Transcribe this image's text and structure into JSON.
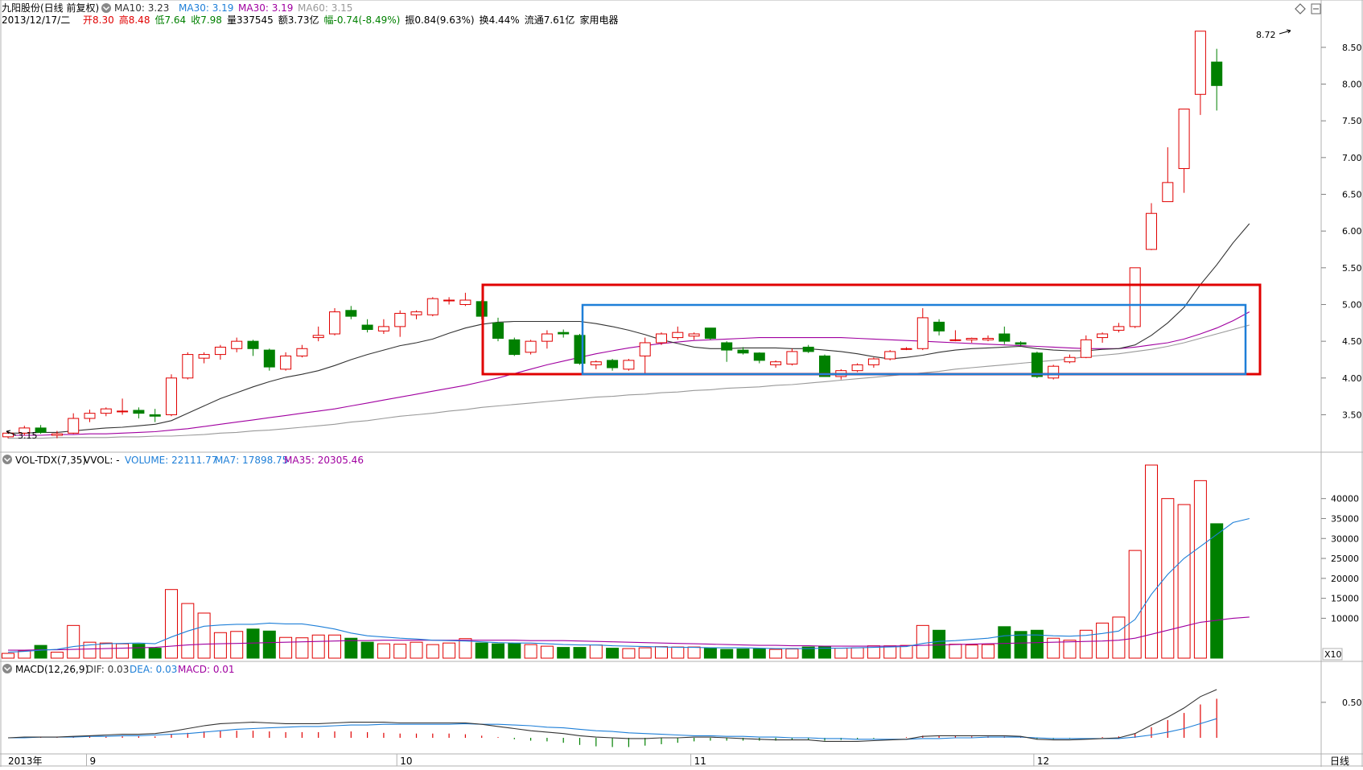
{
  "header": {
    "stock": "九阳股份(日线 前复权)",
    "ma10_label": "MA10: 3.23",
    "ma30a_label": "MA30: 3.19",
    "ma30b_label": "MA30: 3.19",
    "ma60_label": "MA60: 3.15",
    "date": "2013/12/17/二",
    "items": [
      {
        "text": "开8.30",
        "color": "#e00000"
      },
      {
        "text": "高8.48",
        "color": "#e00000"
      },
      {
        "text": "低7.64",
        "color": "#008000"
      },
      {
        "text": "收7.98",
        "color": "#008000"
      },
      {
        "text": "量337545",
        "color": "#000000"
      },
      {
        "text": "额3.73亿",
        "color": "#000000"
      },
      {
        "text": "幅-0.74(-8.49%)",
        "color": "#008000"
      },
      {
        "text": "振0.84(9.63%)",
        "color": "#000000"
      },
      {
        "text": "换4.44%",
        "color": "#000000"
      },
      {
        "text": "流通7.61亿",
        "color": "#000000"
      },
      {
        "text": "家用电器",
        "color": "#000000"
      }
    ]
  },
  "vol_header": {
    "name": "VOL-TDX(7,35)",
    "vvol": "VVOL: -",
    "volume": "VOLUME: 22111.77",
    "ma7": "MA7: 17898.75",
    "ma35": "MA35: 20305.46"
  },
  "macd_header": {
    "name": "MACD(12,26,9)",
    "dif": "DIF: 0.03",
    "dea": "DEA: 0.03",
    "macd": "MACD: 0.01"
  },
  "annotations": {
    "high": "8.72",
    "low": "3.15"
  },
  "x_axis": {
    "year": "2013年",
    "months": [
      "9",
      "10",
      "11",
      "12"
    ]
  },
  "period_label": "日线",
  "vol_unit": "X10",
  "colors": {
    "up": "#e00000",
    "down": "#008000",
    "bg": "#ffffff",
    "grid": "#c0c0c0",
    "ma_short": "#333333",
    "ma_mid": "#a000a0",
    "ma_long": "#999999",
    "ma7": "#1e7fd8",
    "ma35": "#a000a0",
    "dif": "#333333",
    "dea": "#1e7fd8",
    "box_red": "#e00000",
    "box_blue": "#1e7fd8"
  },
  "chart_data": [
    {
      "type": "candlestick",
      "title": "九阳股份(日线 前复权)",
      "price_ticks": [
        "3.50",
        "4.00",
        "4.50",
        "5.00",
        "5.50",
        "6.00",
        "6.50",
        "7.00",
        "7.50",
        "8.00",
        "8.50"
      ],
      "ylim": [
        3.1,
        8.75
      ],
      "ohlc": [
        [
          3.2,
          3.28,
          3.18,
          3.25
        ],
        [
          3.25,
          3.35,
          3.22,
          3.32
        ],
        [
          3.32,
          3.36,
          3.24,
          3.26
        ],
        [
          3.22,
          3.28,
          3.18,
          3.24
        ],
        [
          3.25,
          3.52,
          3.24,
          3.45
        ],
        [
          3.45,
          3.57,
          3.4,
          3.52
        ],
        [
          3.52,
          3.6,
          3.48,
          3.58
        ],
        [
          3.55,
          3.72,
          3.5,
          3.55
        ],
        [
          3.56,
          3.6,
          3.45,
          3.52
        ],
        [
          3.5,
          3.58,
          3.4,
          3.48
        ],
        [
          3.5,
          4.05,
          3.48,
          4.0
        ],
        [
          4.0,
          4.35,
          3.98,
          4.32
        ],
        [
          4.27,
          4.35,
          4.2,
          4.32
        ],
        [
          4.32,
          4.45,
          4.25,
          4.42
        ],
        [
          4.4,
          4.55,
          4.35,
          4.5
        ],
        [
          4.5,
          4.52,
          4.3,
          4.4
        ],
        [
          4.38,
          4.4,
          4.1,
          4.15
        ],
        [
          4.12,
          4.35,
          4.1,
          4.3
        ],
        [
          4.3,
          4.45,
          4.28,
          4.4
        ],
        [
          4.55,
          4.7,
          4.5,
          4.58
        ],
        [
          4.6,
          4.95,
          4.58,
          4.9
        ],
        [
          4.92,
          4.98,
          4.8,
          4.84
        ],
        [
          4.72,
          4.8,
          4.62,
          4.66
        ],
        [
          4.64,
          4.8,
          4.6,
          4.7
        ],
        [
          4.7,
          4.92,
          4.56,
          4.88
        ],
        [
          4.86,
          4.92,
          4.8,
          4.9
        ],
        [
          4.86,
          5.1,
          4.84,
          5.08
        ],
        [
          5.06,
          5.1,
          5.0,
          5.06
        ],
        [
          5.0,
          5.16,
          4.98,
          5.06
        ],
        [
          5.04,
          5.06,
          4.8,
          4.84
        ],
        [
          4.75,
          4.82,
          4.5,
          4.54
        ],
        [
          4.52,
          4.55,
          4.3,
          4.32
        ],
        [
          4.35,
          4.52,
          4.32,
          4.5
        ],
        [
          4.5,
          4.65,
          4.4,
          4.6
        ],
        [
          4.62,
          4.66,
          4.55,
          4.6
        ],
        [
          4.58,
          4.6,
          4.18,
          4.2
        ],
        [
          4.18,
          4.24,
          4.12,
          4.22
        ],
        [
          4.24,
          4.26,
          4.1,
          4.14
        ],
        [
          4.12,
          4.26,
          4.1,
          4.24
        ],
        [
          4.3,
          4.55,
          4.05,
          4.48
        ],
        [
          4.48,
          4.62,
          4.45,
          4.6
        ],
        [
          4.55,
          4.7,
          4.52,
          4.62
        ],
        [
          4.57,
          4.62,
          4.52,
          4.6
        ],
        [
          4.68,
          4.68,
          4.52,
          4.54
        ],
        [
          4.48,
          4.5,
          4.22,
          4.38
        ],
        [
          4.38,
          4.42,
          4.32,
          4.34
        ],
        [
          4.34,
          4.35,
          4.2,
          4.24
        ],
        [
          4.18,
          4.24,
          4.14,
          4.22
        ],
        [
          4.19,
          4.4,
          4.17,
          4.36
        ],
        [
          4.42,
          4.45,
          4.34,
          4.36
        ],
        [
          4.3,
          4.32,
          4.02,
          4.02
        ],
        [
          4.02,
          4.12,
          3.98,
          4.1
        ],
        [
          4.1,
          4.2,
          4.08,
          4.18
        ],
        [
          4.18,
          4.28,
          4.14,
          4.26
        ],
        [
          4.26,
          4.38,
          4.24,
          4.36
        ],
        [
          4.4,
          4.42,
          4.38,
          4.4
        ],
        [
          4.4,
          4.95,
          4.38,
          4.82
        ],
        [
          4.76,
          4.8,
          4.58,
          4.64
        ],
        [
          4.52,
          4.65,
          4.5,
          4.52
        ],
        [
          4.52,
          4.55,
          4.48,
          4.54
        ],
        [
          4.52,
          4.58,
          4.5,
          4.54
        ],
        [
          4.6,
          4.7,
          4.46,
          4.5
        ],
        [
          4.48,
          4.5,
          4.44,
          4.46
        ],
        [
          4.34,
          4.36,
          4.0,
          4.02
        ],
        [
          4.0,
          4.18,
          3.98,
          4.16
        ],
        [
          4.22,
          4.32,
          4.2,
          4.28
        ],
        [
          4.28,
          4.58,
          4.27,
          4.52
        ],
        [
          4.55,
          4.62,
          4.48,
          4.6
        ],
        [
          4.65,
          4.75,
          4.62,
          4.7
        ],
        [
          4.7,
          5.48,
          4.68,
          5.5
        ],
        [
          5.75,
          6.38,
          5.74,
          6.24
        ],
        [
          6.4,
          7.14,
          6.4,
          6.66
        ],
        [
          6.85,
          7.66,
          6.52,
          7.66
        ],
        [
          7.86,
          8.72,
          7.58,
          8.72
        ],
        [
          8.3,
          8.48,
          7.64,
          7.98
        ]
      ],
      "ma_short": [
        3.25,
        3.25,
        3.26,
        3.26,
        3.28,
        3.3,
        3.32,
        3.33,
        3.35,
        3.37,
        3.42,
        3.52,
        3.62,
        3.72,
        3.8,
        3.88,
        3.95,
        4.01,
        4.05,
        4.1,
        4.17,
        4.25,
        4.32,
        4.38,
        4.44,
        4.48,
        4.53,
        4.61,
        4.68,
        4.73,
        4.76,
        4.77,
        4.77,
        4.77,
        4.77,
        4.77,
        4.74,
        4.7,
        4.65,
        4.59,
        4.52,
        4.47,
        4.42,
        4.4,
        4.4,
        4.41,
        4.41,
        4.41,
        4.4,
        4.4,
        4.38,
        4.36,
        4.33,
        4.29,
        4.26,
        4.28,
        4.31,
        4.35,
        4.38,
        4.4,
        4.41,
        4.42,
        4.43,
        4.4,
        4.38,
        4.37,
        4.37,
        4.39,
        4.4,
        4.45,
        4.58,
        4.75,
        4.96,
        5.27,
        5.54,
        5.84,
        6.1
      ],
      "ma_mid": [
        3.22,
        3.22,
        3.22,
        3.23,
        3.23,
        3.24,
        3.24,
        3.25,
        3.26,
        3.27,
        3.29,
        3.31,
        3.34,
        3.37,
        3.4,
        3.43,
        3.46,
        3.49,
        3.52,
        3.55,
        3.58,
        3.62,
        3.66,
        3.7,
        3.74,
        3.78,
        3.82,
        3.86,
        3.9,
        3.95,
        4.0,
        4.06,
        4.12,
        4.18,
        4.23,
        4.28,
        4.33,
        4.37,
        4.41,
        4.44,
        4.47,
        4.49,
        4.51,
        4.52,
        4.53,
        4.54,
        4.55,
        4.55,
        4.55,
        4.55,
        4.55,
        4.55,
        4.54,
        4.53,
        4.52,
        4.51,
        4.5,
        4.49,
        4.48,
        4.47,
        4.46,
        4.45,
        4.44,
        4.43,
        4.42,
        4.41,
        4.4,
        4.4,
        4.4,
        4.42,
        4.45,
        4.48,
        4.53,
        4.6,
        4.68,
        4.78,
        4.9
      ],
      "ma_long": [
        3.18,
        3.18,
        3.18,
        3.19,
        3.19,
        3.19,
        3.19,
        3.2,
        3.2,
        3.21,
        3.21,
        3.22,
        3.23,
        3.25,
        3.26,
        3.28,
        3.29,
        3.31,
        3.33,
        3.35,
        3.37,
        3.4,
        3.42,
        3.45,
        3.48,
        3.5,
        3.52,
        3.55,
        3.57,
        3.6,
        3.62,
        3.64,
        3.66,
        3.68,
        3.7,
        3.72,
        3.74,
        3.75,
        3.77,
        3.78,
        3.8,
        3.81,
        3.83,
        3.84,
        3.86,
        3.87,
        3.88,
        3.9,
        3.91,
        3.93,
        3.95,
        3.97,
        3.99,
        4.01,
        4.03,
        4.05,
        4.07,
        4.09,
        4.12,
        4.14,
        4.16,
        4.18,
        4.2,
        4.22,
        4.24,
        4.26,
        4.29,
        4.31,
        4.33,
        4.36,
        4.39,
        4.43,
        4.48,
        4.54,
        4.6,
        4.66,
        4.72
      ]
    },
    {
      "type": "bar",
      "title": "VOL-TDX(7,35)",
      "y_ticks": [
        "10000",
        "15000",
        "20000",
        "25000",
        "30000",
        "35000",
        "40000"
      ],
      "ylim": [
        0,
        48000
      ],
      "volume": [
        1200,
        1800,
        3200,
        1500,
        8200,
        4000,
        3800,
        3600,
        3500,
        2500,
        17200,
        13700,
        11300,
        6400,
        6700,
        7300,
        6800,
        5200,
        5100,
        5800,
        5800,
        5000,
        4000,
        3600,
        3500,
        4000,
        3400,
        3800,
        4900,
        3800,
        3600,
        3700,
        3400,
        3000,
        2700,
        2700,
        3300,
        2500,
        2400,
        2600,
        2900,
        2800,
        2800,
        2500,
        2200,
        2300,
        2300,
        2200,
        2300,
        2800,
        2900,
        2500,
        2600,
        3100,
        3100,
        3200,
        8200,
        7000,
        3500,
        3300,
        3400,
        7900,
        6700,
        7000,
        5000,
        4500,
        7000,
        8800,
        10300,
        27000,
        50000,
        40000,
        38500,
        44500,
        33700
      ],
      "ma7": [
        1500,
        1700,
        2000,
        2200,
        2900,
        3300,
        3600,
        3700,
        3800,
        3600,
        5300,
        6800,
        8000,
        8300,
        8500,
        8500,
        8800,
        8600,
        8600,
        8000,
        7300,
        6300,
        5600,
        5300,
        5000,
        4800,
        4500,
        4400,
        4300,
        4100,
        3900,
        3800,
        3800,
        3600,
        3400,
        3300,
        3300,
        3100,
        3000,
        2900,
        2800,
        2700,
        2700,
        2600,
        2600,
        2600,
        2500,
        2400,
        2400,
        2400,
        2500,
        2500,
        2600,
        2700,
        2800,
        2900,
        3700,
        4200,
        4400,
        4700,
        5000,
        5600,
        5800,
        5800,
        5600,
        5500,
        5700,
        6200,
        6800,
        9700,
        16000,
        21000,
        25000,
        28000,
        31000,
        34000,
        35000
      ],
      "ma35": [
        2000,
        2000,
        2100,
        2100,
        2200,
        2300,
        2400,
        2500,
        2600,
        2700,
        3000,
        3300,
        3500,
        3600,
        3700,
        3800,
        3900,
        4000,
        4100,
        4200,
        4300,
        4400,
        4400,
        4500,
        4500,
        4500,
        4500,
        4500,
        4500,
        4500,
        4500,
        4500,
        4400,
        4400,
        4400,
        4300,
        4200,
        4100,
        4000,
        3900,
        3800,
        3700,
        3600,
        3500,
        3400,
        3300,
        3200,
        3200,
        3100,
        3100,
        3000,
        3000,
        3000,
        3000,
        3000,
        3100,
        3200,
        3300,
        3400,
        3500,
        3600,
        3700,
        3800,
        3900,
        4000,
        4100,
        4200,
        4300,
        4500,
        5000,
        6000,
        7000,
        8000,
        9000,
        9500,
        10000,
        10300
      ]
    },
    {
      "type": "bar",
      "title": "MACD(12,26,9)",
      "y_ticks": [
        "0.50"
      ],
      "ylim": [
        -0.15,
        0.85
      ],
      "macd": [
        0.0,
        0.01,
        0.01,
        0.01,
        0.02,
        0.02,
        0.02,
        0.02,
        0.02,
        0.02,
        0.05,
        0.07,
        0.09,
        0.1,
        0.1,
        0.1,
        0.09,
        0.08,
        0.08,
        0.08,
        0.09,
        0.09,
        0.08,
        0.07,
        0.06,
        0.06,
        0.06,
        0.06,
        0.05,
        0.03,
        0.01,
        -0.02,
        -0.04,
        -0.05,
        -0.07,
        -0.1,
        -0.12,
        -0.13,
        -0.13,
        -0.11,
        -0.09,
        -0.07,
        -0.05,
        -0.04,
        -0.04,
        -0.04,
        -0.04,
        -0.04,
        -0.03,
        -0.03,
        -0.04,
        -0.03,
        -0.02,
        -0.01,
        0.0,
        0.01,
        0.03,
        0.03,
        0.03,
        0.02,
        0.02,
        0.02,
        0.01,
        -0.02,
        -0.02,
        -0.01,
        0.0,
        0.01,
        0.02,
        0.06,
        0.15,
        0.25,
        0.35,
        0.47,
        0.55
      ],
      "dif": [
        0.0,
        0.01,
        0.01,
        0.01,
        0.02,
        0.03,
        0.04,
        0.05,
        0.05,
        0.06,
        0.09,
        0.13,
        0.17,
        0.2,
        0.21,
        0.22,
        0.21,
        0.2,
        0.2,
        0.2,
        0.21,
        0.22,
        0.22,
        0.22,
        0.21,
        0.21,
        0.21,
        0.21,
        0.21,
        0.19,
        0.16,
        0.13,
        0.1,
        0.08,
        0.06,
        0.03,
        0.01,
        0.0,
        -0.01,
        -0.01,
        0.0,
        0.0,
        0.01,
        0.01,
        0.0,
        -0.01,
        -0.02,
        -0.03,
        -0.03,
        -0.03,
        -0.05,
        -0.05,
        -0.05,
        -0.04,
        -0.03,
        -0.02,
        0.02,
        0.03,
        0.03,
        0.03,
        0.03,
        0.03,
        0.02,
        -0.02,
        -0.03,
        -0.03,
        -0.02,
        -0.01,
        0.0,
        0.06,
        0.18,
        0.29,
        0.42,
        0.58,
        0.68
      ],
      "dea": [
        0.0,
        0.0,
        0.01,
        0.01,
        0.01,
        0.02,
        0.02,
        0.03,
        0.03,
        0.04,
        0.05,
        0.06,
        0.08,
        0.1,
        0.12,
        0.13,
        0.14,
        0.15,
        0.16,
        0.16,
        0.17,
        0.18,
        0.18,
        0.19,
        0.19,
        0.19,
        0.19,
        0.19,
        0.2,
        0.19,
        0.19,
        0.18,
        0.17,
        0.15,
        0.14,
        0.12,
        0.1,
        0.09,
        0.07,
        0.06,
        0.05,
        0.04,
        0.03,
        0.03,
        0.02,
        0.02,
        0.01,
        0.01,
        0.0,
        0.0,
        -0.01,
        -0.01,
        -0.02,
        -0.02,
        -0.02,
        -0.02,
        -0.01,
        -0.01,
        0.0,
        0.0,
        0.01,
        0.01,
        0.01,
        0.0,
        -0.01,
        -0.01,
        -0.01,
        -0.01,
        -0.01,
        0.01,
        0.04,
        0.08,
        0.13,
        0.2,
        0.27
      ]
    }
  ]
}
